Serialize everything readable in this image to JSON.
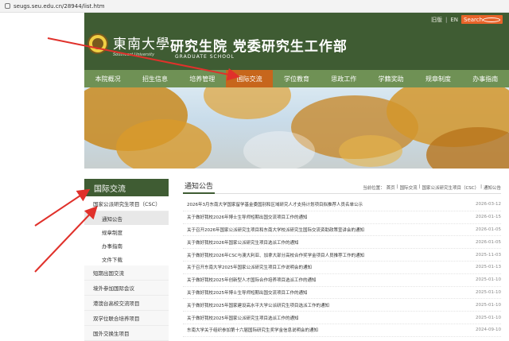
{
  "browser": {
    "url": "seugs.seu.edu.cn/28944/list.htm"
  },
  "header": {
    "top_links": [
      "旧版",
      "EN"
    ],
    "search_placeholder": "Search",
    "university_cn": "東南大學",
    "university_en": "Southeast University",
    "title": "研究生院  党委研究生工作部",
    "subtitle": "GRADUATE SCHOOL"
  },
  "nav": [
    "本院概况",
    "招生信息",
    "培养管理",
    "国际交流",
    "学位教育",
    "思政工作",
    "学籍奖助",
    "规章制度",
    "办事指南"
  ],
  "nav_active": "国际交流",
  "sidebar": {
    "title": "国际交流",
    "main_item": "国家公派研究生项目（CSC）",
    "sub_items": [
      "通知公告",
      "规章制度",
      "办事指南",
      "文件下载"
    ],
    "active_sub": "通知公告",
    "other_items": [
      "短期出国交流",
      "境外参加国际会议",
      "港澳台高校交流项目",
      "双学位联合培养项目",
      "国外交换生项目"
    ]
  },
  "content": {
    "title": "通知公告",
    "breadcrumb": [
      "当前位置：",
      "首页",
      "|",
      "国际交流",
      "|",
      "国家公派研究生项目（CSC）",
      "|",
      "通知公告"
    ],
    "news": [
      {
        "title": "2026年3月东南大学国家留学基金委国别和区域研究人才支持计划项目拟推荐人员名单公示",
        "date": "2026-03-12"
      },
      {
        "title": "关于做好我校2026年博士生导师短期出国交流项目工作的通知",
        "date": "2026-01-15"
      },
      {
        "title": "关于召开2026年国家公派研究生项目和东南大学校派研究生国际交流资助政策宣讲会的通知",
        "date": "2026-01-05"
      },
      {
        "title": "关于做好我校2026年国家公派研究生项目选派工作的通知",
        "date": "2026-01-05"
      },
      {
        "title": "关于做好我校2026年CSC与澳大利亚、加拿大部分高校合作奖学金项目人员推荐工作的通知",
        "date": "2025-11-03"
      },
      {
        "title": "关于召开东南大学2025年国家公派研究生项目工作说明会的通知",
        "date": "2025-01-13"
      },
      {
        "title": "关于做好我校2025年创新型人才国际合作培养项目选派工作的通知",
        "date": "2025-01-10"
      },
      {
        "title": "关于做好我校2025年博士生导师短期出国交流项目工作的通知",
        "date": "2025-01-10"
      },
      {
        "title": "关于做好我校2025年国家建设高水平大学公派研究生项目选派工作的通知",
        "date": "2025-01-10"
      },
      {
        "title": "关于做好我校2025年国家公派研究生项目选派工作的通知",
        "date": "2025-01-10"
      },
      {
        "title": "东南大学关于组织参加第十六届国际研究生奖学金信息说明会的通知",
        "date": "2024-09-10"
      }
    ]
  },
  "colors": {
    "header_green": "#3f5c33",
    "nav_green": "#6f9155",
    "nav_active": "#c7661c",
    "search_orange": "#e8642a",
    "annotation_red": "#e0312b"
  },
  "icons": [
    "lock-icon",
    "search-icon",
    "university-logo",
    "arrow-annotation"
  ]
}
